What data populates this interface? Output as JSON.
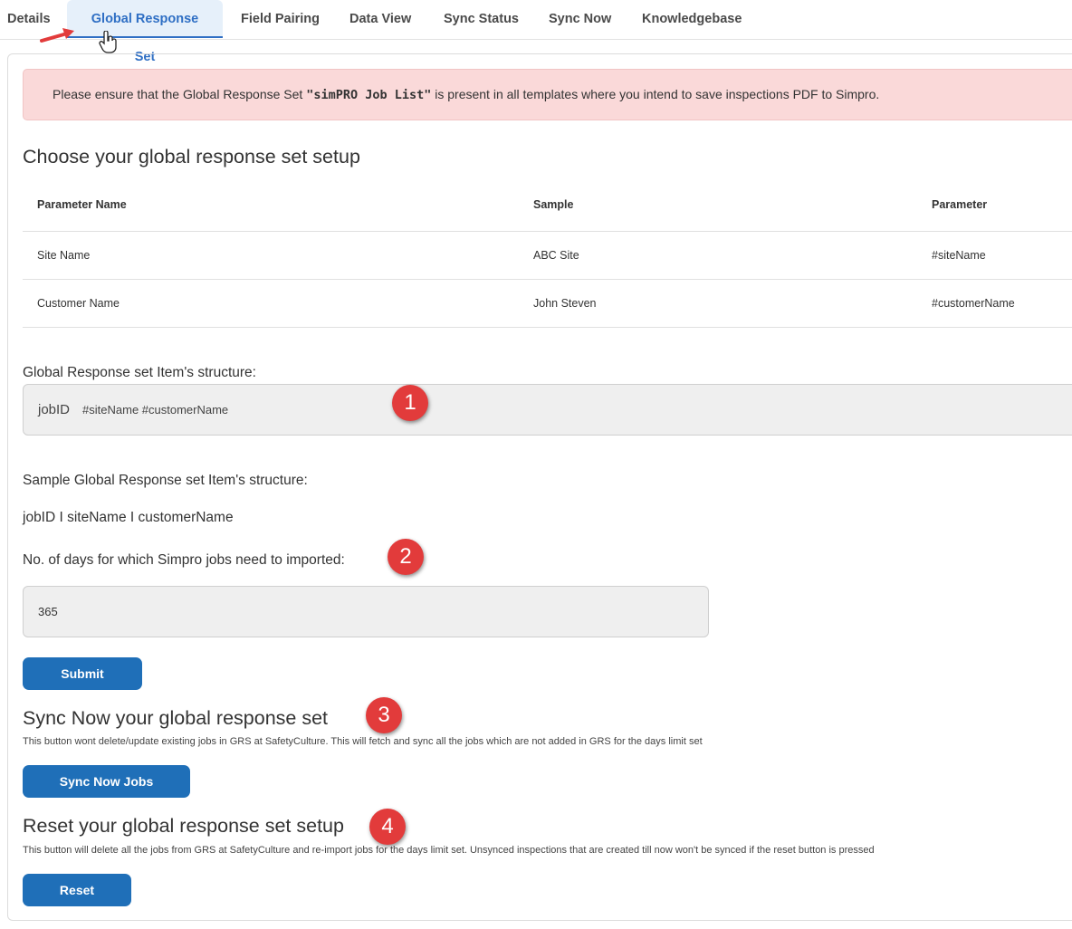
{
  "tabs": [
    "Details",
    "Global Response Set",
    "Field Pairing",
    "Data View",
    "Sync Status",
    "Sync Now",
    "Knowledgebase"
  ],
  "active_tab": "Global Response Set",
  "alert": {
    "prefix": "Please ensure that the Global Response Set ",
    "highlight": "\"simPRO Job List\"",
    "suffix": " is present in all templates where you intend to save inspections PDF to Simpro."
  },
  "setup": {
    "title": "Choose your global response set setup",
    "columns": [
      "Parameter Name",
      "Sample",
      "Parameter"
    ],
    "rows": [
      [
        "Site Name",
        "ABC Site",
        "#siteName"
      ],
      [
        "Customer Name",
        "John Steven",
        "#customerName"
      ]
    ]
  },
  "structure": {
    "label": "Global Response set Item's structure:",
    "token_job": "jobID",
    "token_params": "#siteName #customerName"
  },
  "sample": {
    "label": "Sample Global Response set Item's structure:",
    "value": "jobID I siteName I customerName"
  },
  "days": {
    "label": "No. of days for which Simpro jobs need to imported:",
    "value": "365"
  },
  "submit_label": "Submit",
  "sync": {
    "title": "Sync Now your global response set",
    "note": "This button wont delete/update existing jobs in GRS at SafetyCulture. This will fetch and sync all the jobs which are not added in GRS for the days limit set",
    "button": "Sync Now Jobs"
  },
  "reset": {
    "title": "Reset your global response set setup",
    "note": "This button will delete all the jobs from GRS at SafetyCulture and re-import jobs for the days limit set. Unsynced inspections that are created till now won't be synced if the reset button is pressed",
    "button": "Reset"
  },
  "badges": [
    "1",
    "2",
    "3",
    "4"
  ],
  "colors": {
    "accent": "#1f6fb8",
    "alert_bg": "#fad9d9",
    "badge": "#e23b3b"
  },
  "icons": [
    "red-arrow-icon",
    "hand-cursor-icon"
  ]
}
